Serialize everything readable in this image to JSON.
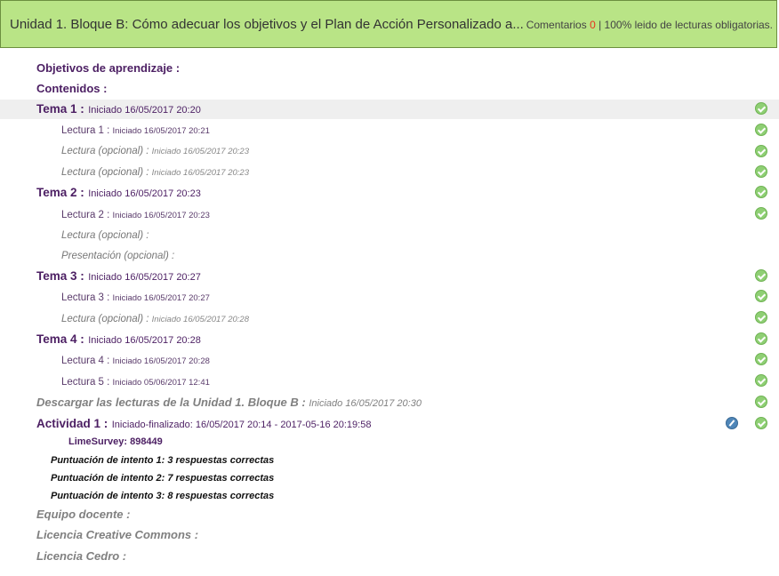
{
  "header": {
    "title": "Unidad 1. Bloque B: Cómo adecuar los objetivos y el Plan de Acción Personalizado a...",
    "comments_label": "Comentarios",
    "comments_count": "0",
    "separator": " | ",
    "reading_status": "100% leido de lecturas obligatorias."
  },
  "sections": {
    "objetivos": "Objetivos de aprendizaje :",
    "contenidos": "Contenidos :"
  },
  "temas": [
    {
      "label": "Tema 1 :",
      "status": "Iniciado 16/05/2017 20:20",
      "items": [
        {
          "label": "Lectura 1 :",
          "status": "Iniciado 16/05/2017 20:21"
        },
        {
          "label": "Lectura (opcional) :",
          "status": "Iniciado 16/05/2017 20:23"
        },
        {
          "label": "Lectura (opcional) :",
          "status": "Iniciado 16/05/2017 20:23"
        }
      ]
    },
    {
      "label": "Tema 2 :",
      "status": "Iniciado 16/05/2017 20:23",
      "items": [
        {
          "label": "Lectura 2 :",
          "status": "Iniciado 16/05/2017 20:23"
        },
        {
          "label": "Lectura (opcional) :",
          "status": ""
        },
        {
          "label": "Presentación (opcional) :",
          "status": ""
        }
      ]
    },
    {
      "label": "Tema 3 :",
      "status": "Iniciado 16/05/2017 20:27",
      "items": [
        {
          "label": "Lectura 3 :",
          "status": "Iniciado 16/05/2017 20:27"
        },
        {
          "label": "Lectura (opcional) :",
          "status": "Iniciado 16/05/2017 20:28"
        }
      ]
    },
    {
      "label": "Tema 4 :",
      "status": "Iniciado 16/05/2017 20:28",
      "items": [
        {
          "label": "Lectura 4 :",
          "status": "Iniciado 16/05/2017 20:28"
        },
        {
          "label": "Lectura 5 :",
          "status": "Iniciado 05/06/2017 12:41"
        }
      ]
    }
  ],
  "descargar": {
    "label": "Descargar las lecturas de la Unidad 1. Bloque B :",
    "status": "Iniciado 16/05/2017 20:30"
  },
  "actividad": {
    "label": "Actividad 1 :",
    "status": "Iniciado-finalizado: 16/05/2017 20:14 - 2017-05-16 20:19:58",
    "limesurvey": "LimeSurvey: 898449",
    "intentos": [
      "Puntuación de intento 1: 3 respuestas correctas",
      "Puntuación de intento 2: 7 respuestas correctas",
      "Puntuación de intento 3: 8 respuestas correctas"
    ]
  },
  "footer": {
    "equipo": "Equipo docente :",
    "licencia_cc": "Licencia Creative Commons :",
    "licencia_cedro": "Licencia Cedro :"
  },
  "colors": {
    "header_bg": "#b9e486",
    "accent_purple": "#4c1f63",
    "check_green": "#8fcf74",
    "comment_count": "#e8321e"
  },
  "icons": {
    "completed": "check-circle-icon",
    "edit": "pencil-circle-icon"
  }
}
